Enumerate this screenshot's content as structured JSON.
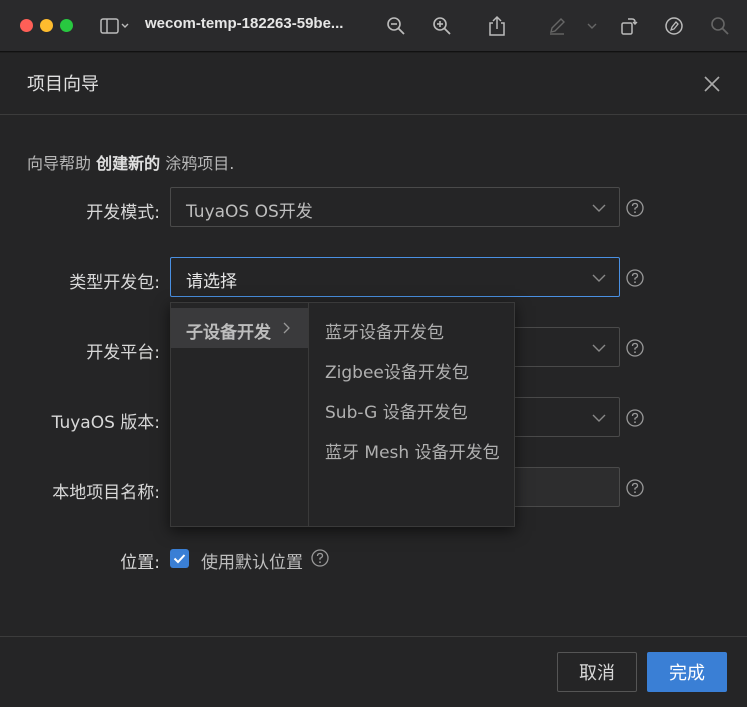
{
  "window": {
    "title": "wecom-temp-182263-59be..."
  },
  "dialog": {
    "title": "项目向导",
    "intro_prefix": "向导帮助",
    "intro_bold": "创建新的",
    "intro_suffix": "涂鸦项目."
  },
  "form": {
    "dev_mode": {
      "label": "开发模式:",
      "value": "TuyaOS OS开发"
    },
    "dev_kit": {
      "label": "类型开发包:",
      "value": "请选择"
    },
    "dev_platform": {
      "label": "开发平台:"
    },
    "tuyaos_version": {
      "label": "TuyaOS 版本:"
    },
    "local_project_name": {
      "label": "本地项目名称:"
    },
    "location": {
      "label": "位置:",
      "checkbox_label": "使用默认位置",
      "checked": true
    }
  },
  "cascader": {
    "level1": [
      {
        "label": "子设备开发",
        "selected": true
      }
    ],
    "level2": [
      "蓝牙设备开发包",
      "Zigbee设备开发包",
      "Sub-G 设备开发包",
      "蓝牙 Mesh 设备开发包"
    ]
  },
  "footer": {
    "cancel_label": "取消",
    "done_label": "完成"
  },
  "colors": {
    "accent": "#3a7fd5",
    "background": "#252526"
  }
}
